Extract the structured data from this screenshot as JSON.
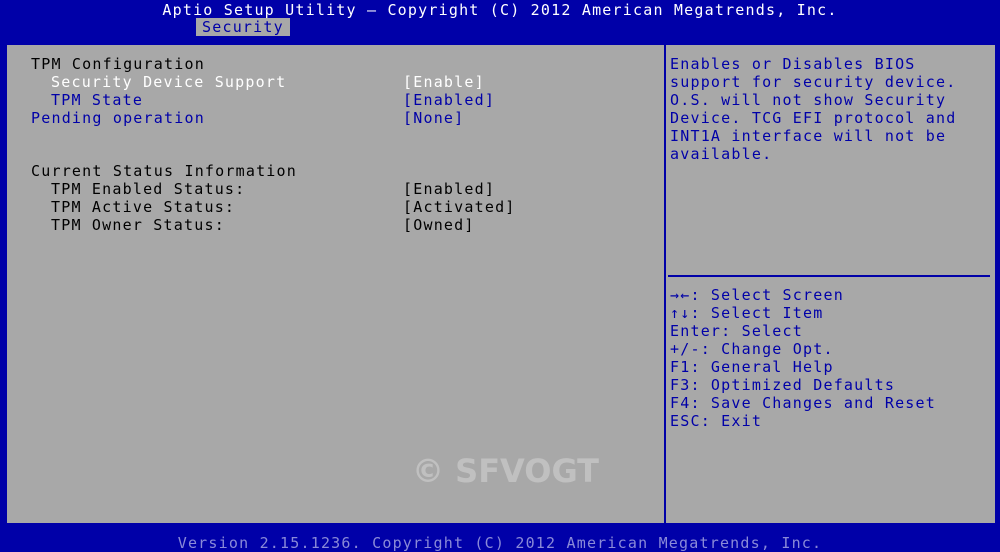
{
  "header": {
    "title": "Aptio Setup Utility – Copyright (C) 2012 American Megatrends, Inc.",
    "active_tab": "Security"
  },
  "settings": {
    "tpm_configuration_heading": "TPM Configuration",
    "security_device_support": {
      "label": "Security Device Support",
      "value": "[Enable]"
    },
    "tpm_state": {
      "label": "TPM State",
      "value": "[Enabled]"
    },
    "pending_operation": {
      "label": "Pending operation",
      "value": "[None]"
    },
    "current_status_heading": "Current Status Information",
    "tpm_enabled_status": {
      "label": "TPM Enabled Status:",
      "value": "[Enabled]"
    },
    "tpm_active_status": {
      "label": "TPM Active Status:",
      "value": "[Activated]"
    },
    "tpm_owner_status": {
      "label": "TPM Owner Status:",
      "value": "[Owned]"
    }
  },
  "help": {
    "description": "Enables or Disables BIOS\nsupport for security device.\nO.S. will not show Security\nDevice. TCG EFI protocol and\nINT1A interface will not be\navailable.",
    "keys": [
      "→←: Select Screen",
      "↑↓: Select Item",
      "Enter: Select",
      "+/-: Change Opt.",
      "F1: General Help",
      "F3: Optimized Defaults",
      "F4: Save Changes and Reset",
      "ESC: Exit"
    ]
  },
  "watermark": "© SFVOGT",
  "footer": "Version 2.15.1236. Copyright (C) 2012 American Megatrends, Inc.",
  "colors": {
    "background": "#0000a8",
    "panel": "#a8a8a8",
    "highlight": "#ffffff",
    "text": "#000000"
  }
}
